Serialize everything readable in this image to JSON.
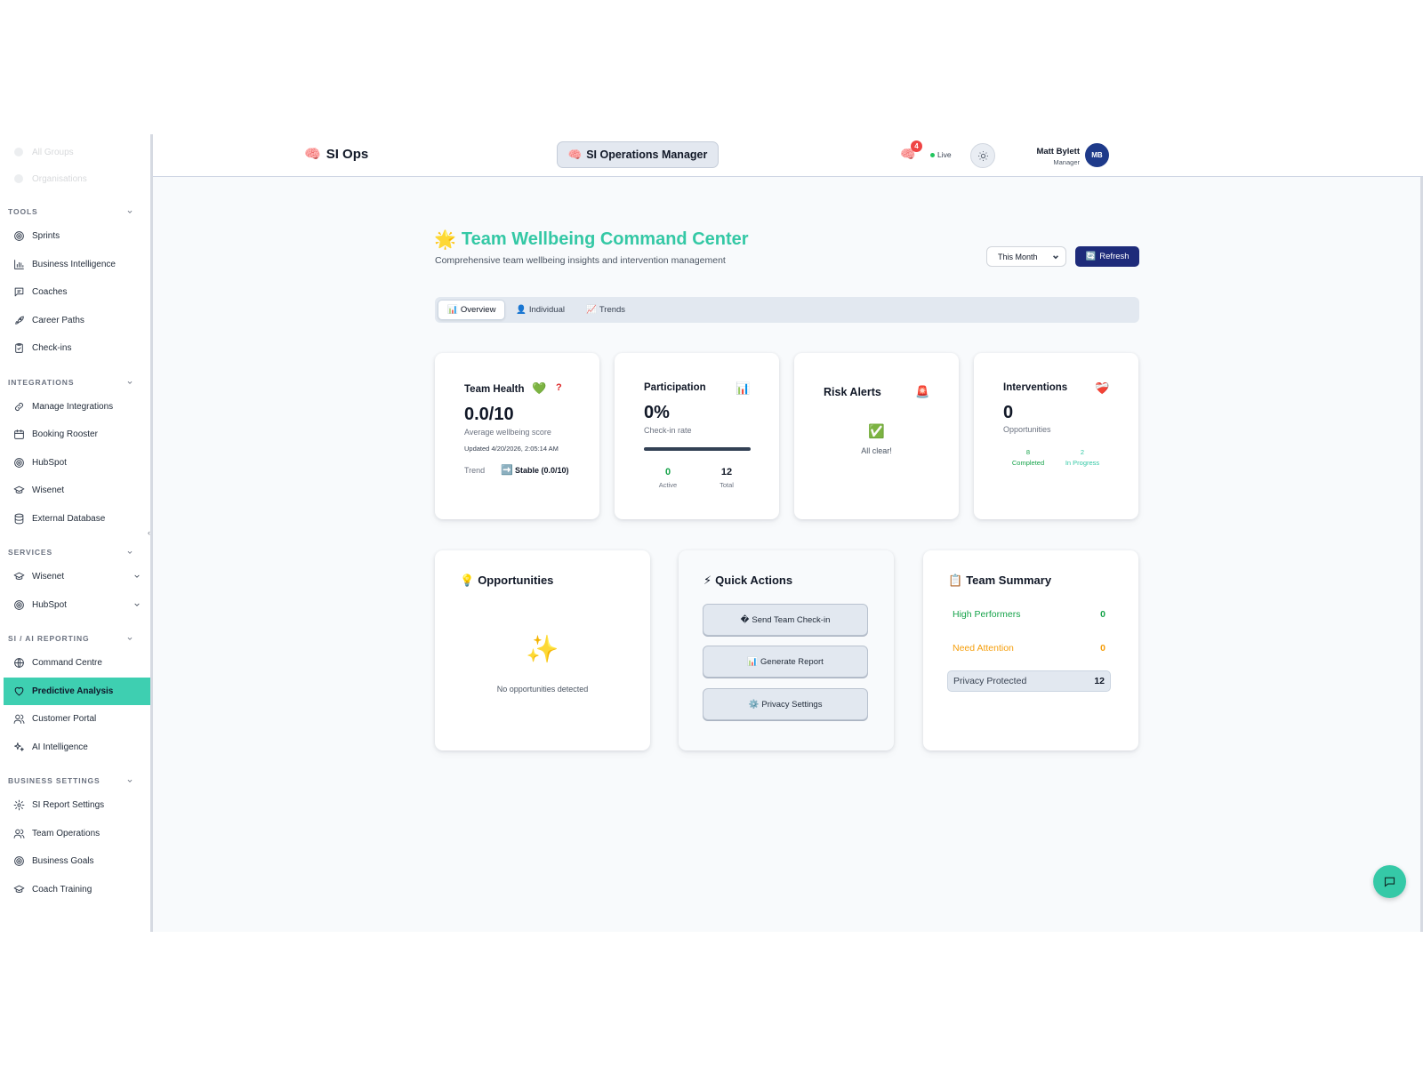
{
  "sidebar": {
    "faded_items": [
      "All Groups",
      "Organisations"
    ],
    "sections": [
      {
        "title": "TOOLS",
        "items": [
          {
            "label": "Sprints",
            "icon": "target-icon"
          },
          {
            "label": "Business Intelligence",
            "icon": "bar-chart-icon"
          },
          {
            "label": "Coaches",
            "icon": "message-square-icon"
          },
          {
            "label": "Career Paths",
            "icon": "rocket-icon"
          },
          {
            "label": "Check-ins",
            "icon": "clipboard-check-icon"
          }
        ]
      },
      {
        "title": "INTEGRATIONS",
        "items": [
          {
            "label": "Manage Integrations",
            "icon": "link-icon"
          },
          {
            "label": "Booking Rooster",
            "icon": "calendar-icon"
          },
          {
            "label": "HubSpot",
            "icon": "target-icon"
          },
          {
            "label": "Wisenet",
            "icon": "graduation-cap-icon"
          },
          {
            "label": "External Database",
            "icon": "database-icon"
          }
        ]
      },
      {
        "title": "SERVICES",
        "items": [
          {
            "label": "Wisenet",
            "icon": "graduation-cap-icon",
            "expandable": true
          },
          {
            "label": "HubSpot",
            "icon": "target-icon",
            "expandable": true
          }
        ]
      },
      {
        "title": "SI / AI REPORTING",
        "items": [
          {
            "label": "Command Centre",
            "icon": "globe-icon"
          },
          {
            "label": "Predictive Analysis",
            "icon": "heart-icon",
            "active": true
          },
          {
            "label": "Customer Portal",
            "icon": "users-icon"
          },
          {
            "label": "AI Intelligence",
            "icon": "sparkles-icon"
          }
        ]
      },
      {
        "title": "BUSINESS SETTINGS",
        "items": [
          {
            "label": "SI Report Settings",
            "icon": "gear-icon"
          },
          {
            "label": "Team Operations",
            "icon": "users-icon"
          },
          {
            "label": "Business Goals",
            "icon": "target-icon"
          },
          {
            "label": "Coach Training",
            "icon": "graduation-cap-icon"
          }
        ]
      }
    ]
  },
  "header": {
    "brand_emoji": "🧠",
    "brand": "SI Ops",
    "role_emoji": "🧠",
    "role": "SI Operations Manager",
    "notifications": "4",
    "live": "Live",
    "user_name": "Matt Bylett",
    "user_role": "Manager",
    "user_initials": "MB"
  },
  "page": {
    "title_emoji": "🌟",
    "title": "Team Wellbeing Command Center",
    "subtitle": "Comprehensive team wellbeing insights and intervention management",
    "period": "This Month",
    "refresh_emoji": "🔄",
    "refresh": "Refresh",
    "tabs": [
      {
        "emoji": "📊",
        "label": "Overview"
      },
      {
        "emoji": "👤",
        "label": "Individual"
      },
      {
        "emoji": "📈",
        "label": "Trends"
      }
    ]
  },
  "cards": {
    "team_health": {
      "title": "Team Health",
      "icon": "💚",
      "help": "?",
      "score": "0.0/10",
      "label": "Average wellbeing score",
      "updated": "Updated 4/20/2026, 2:05:14 AM",
      "trend_label": "Trend",
      "trend_emoji": "➡️",
      "trend_value": "Stable (0.0/10)"
    },
    "participation": {
      "title": "Participation",
      "icon": "📊",
      "value": "0%",
      "label": "Check-in rate",
      "progress": 0,
      "active_value": "0",
      "active_label": "Active",
      "total_value": "12",
      "total_label": "Total"
    },
    "risk_alerts": {
      "title": "Risk Alerts",
      "icon": "🚨",
      "status_icon": "✅",
      "status": "All clear!"
    },
    "interventions": {
      "title": "Interventions",
      "icon": "❤️‍🩹",
      "value": "0",
      "label": "Opportunities",
      "completed_value": "8",
      "completed_label": "Completed",
      "in_progress_value": "2",
      "in_progress_label": "In Progress"
    },
    "opportunities": {
      "title_emoji": "💡",
      "title": "Opportunities",
      "empty_icon": "✨",
      "empty_text": "No opportunities detected"
    },
    "quick_actions": {
      "title_emoji": "⚡",
      "title": "Quick Actions",
      "buttons": [
        {
          "emoji": "�",
          "label": "Send Team Check-in"
        },
        {
          "emoji": "📊",
          "label": "Generate Report"
        },
        {
          "emoji": "⚙️",
          "label": "Privacy Settings"
        }
      ]
    },
    "team_summary": {
      "title_emoji": "📋",
      "title": "Team Summary",
      "rows": [
        {
          "label": "High Performers",
          "value": "0",
          "color": "#16a34a"
        },
        {
          "label": "Need Attention",
          "value": "0",
          "color": "#f59e0b"
        },
        {
          "label": "Privacy Protected",
          "value": "12",
          "color": "#374151"
        }
      ]
    }
  },
  "colors": {
    "accent": "#3ecfb1",
    "brand_dark": "#1e2b7a",
    "progress_track": "#334155"
  }
}
